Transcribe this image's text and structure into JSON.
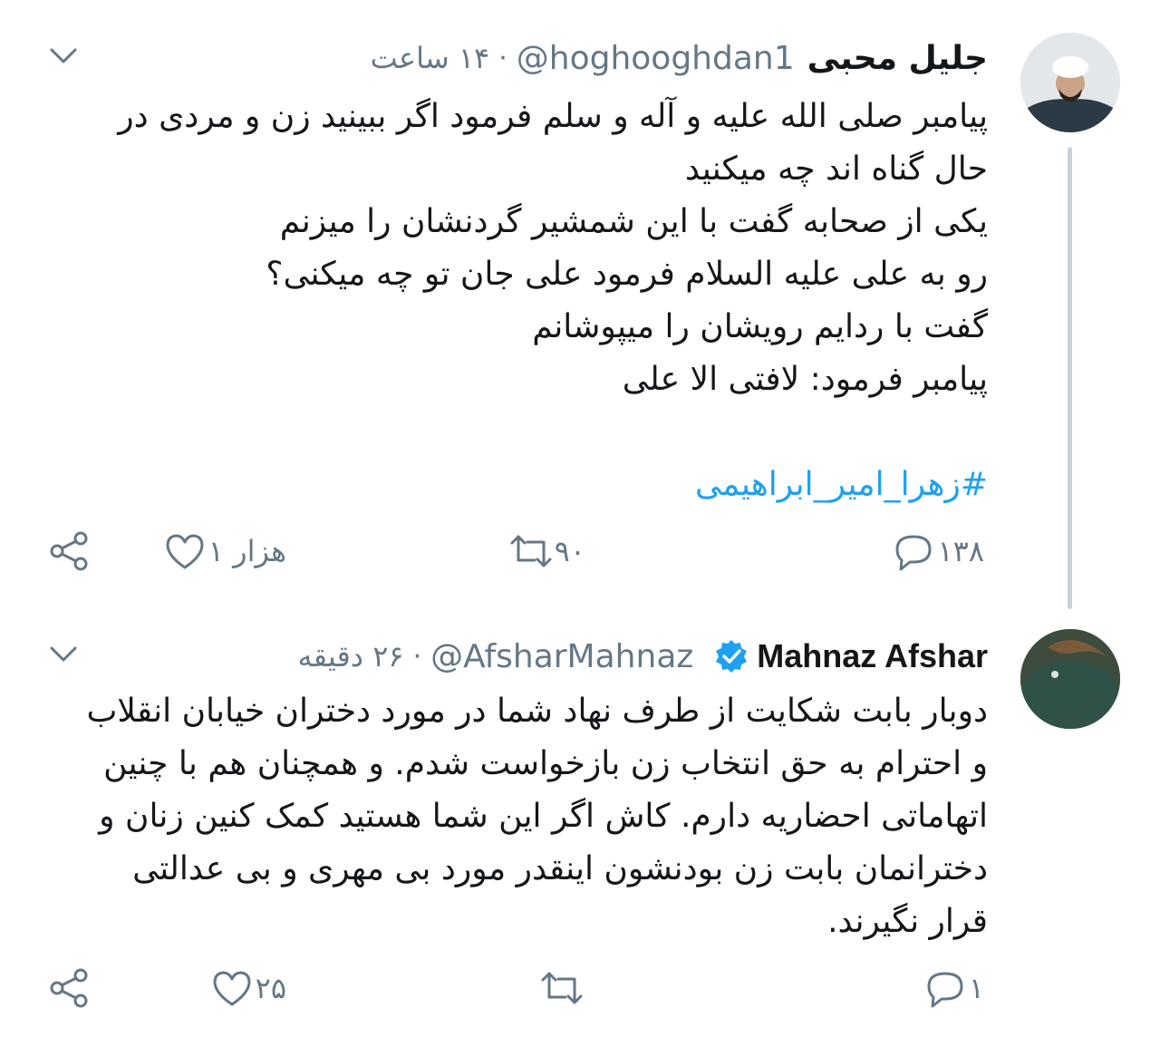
{
  "tweets": [
    {
      "name": "جلیل محبی",
      "handle": "@hoghooghdan1",
      "separator": "·",
      "time": "۱۴ ساعت",
      "lines": [
        "پیامبر صلی الله علیه و آله و سلم فرمود اگر ببینید زن و مردی در",
        "حال گناه اند چه میکنید",
        "یکی از صحابه گفت با این شمشیر گردنشان را میزنم",
        "رو به علی علیه السلام فرمود علی جان تو چه میکنی؟",
        "گفت با ردایم رویشان را میپوشانم",
        "پیامبر فرمود: لافتی الا علی"
      ],
      "hashtag": "#زهرا_امیر_ابراهیمی",
      "replies": "۱۳۸",
      "retweets": "۹۰",
      "likes": "۱ هزار",
      "icons": {
        "reply": "reply-icon",
        "retweet": "retweet-icon",
        "like": "heart-icon",
        "share": "share-icon",
        "menu": "chevron-down-icon"
      }
    },
    {
      "name": "Mahnaz Afshar",
      "handle": "@AfsharMahnaz",
      "separator": "·",
      "time": "۲۶ دقیقه",
      "verified": true,
      "lines": [
        "دوبار بابت شکایت از طرف نهاد شما در مورد دختران خیابان انقلاب",
        "و احترام به حق انتخاب زن بازخواست شدم. و همچنان هم با چنین",
        "اتهاماتی احضاریه دارم. کاش اگر این شما هستید کمک کنین زنان و",
        "دخترانمان بابت زن بودنشون اینقدر مورد بی مهری و بی عدالتی",
        "قرار نگیرند."
      ],
      "replies": "۱",
      "retweets": "",
      "likes": "۲۵",
      "icons": {
        "reply": "reply-icon",
        "retweet": "retweet-icon",
        "like": "heart-icon",
        "share": "share-icon",
        "menu": "chevron-down-icon",
        "verified": "verified-badge-icon"
      }
    }
  ],
  "colors": {
    "text": "#14171a",
    "secondary": "#657786",
    "accent": "#1da1f2",
    "thread_line": "#c9d2da"
  }
}
